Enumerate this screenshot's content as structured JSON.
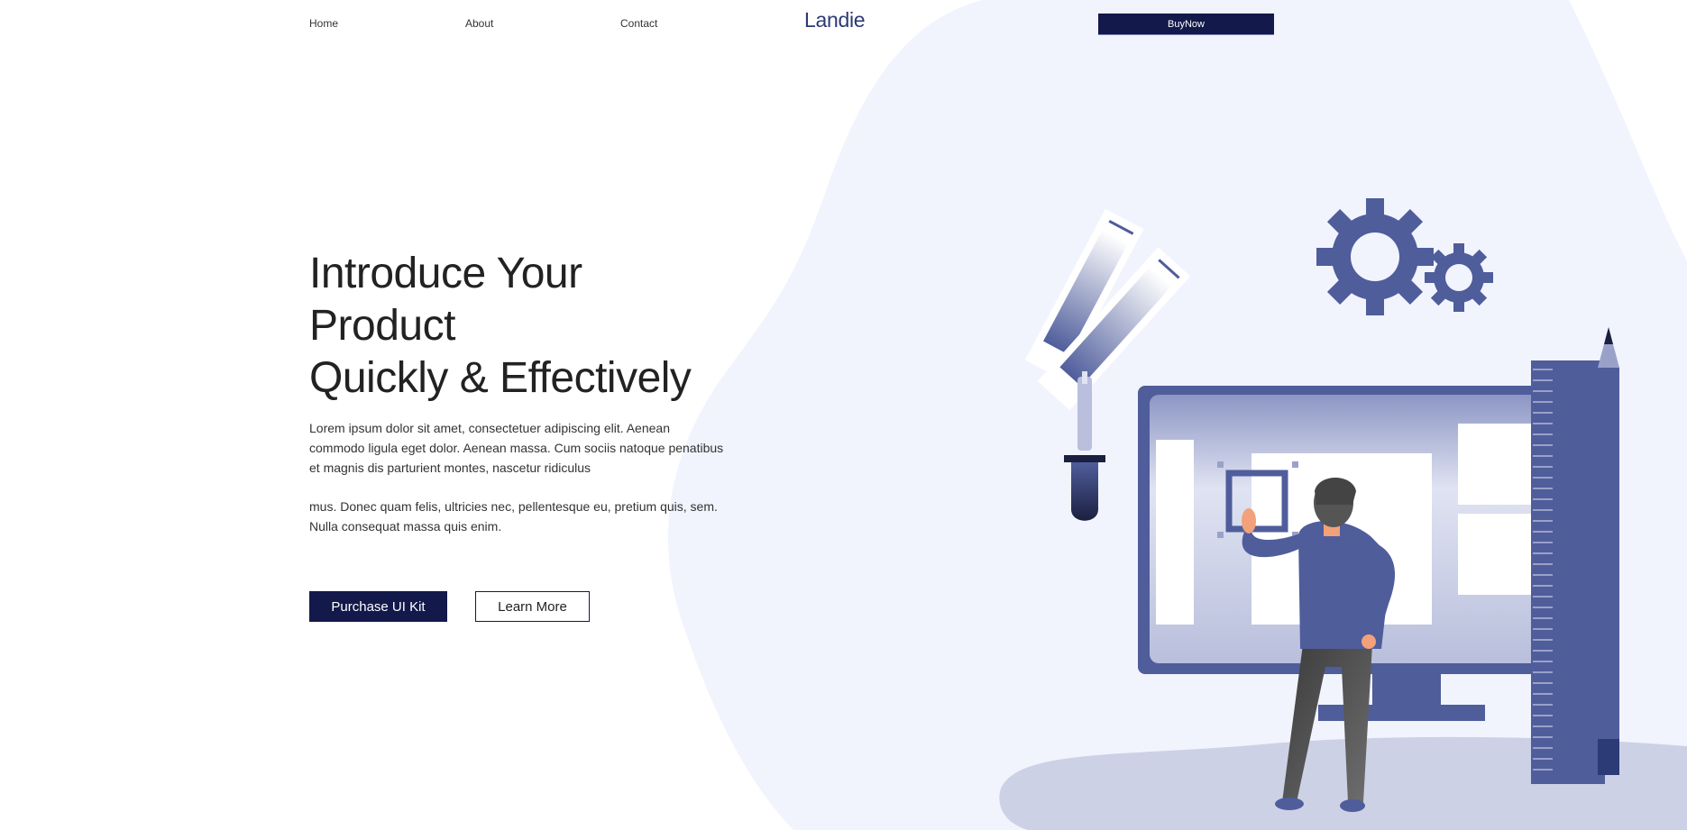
{
  "nav": {
    "links": [
      "Home",
      "About",
      "Contact"
    ],
    "brand": "Landie",
    "cta": "BuyNow"
  },
  "hero": {
    "title_lines": [
      "Introduce Your",
      "Product",
      "Quickly & Effectively"
    ],
    "paragraph_1": "Lorem ipsum dolor sit amet, consectetuer adipiscing elit. Aenean commodo ligula eget dolor. Aenean massa. Cum sociis natoque penatibus et magnis dis parturient montes, nascetur ridiculus",
    "paragraph_2": "mus. Donec quam felis, ultricies nec, pellentesque eu, pretium quis, sem. Nulla consequat massa quis enim.",
    "primary_button": "Purchase UI Kit",
    "secondary_button": "Learn More"
  },
  "colors": {
    "navy": "#13194a",
    "brand": "#2c3a75",
    "accent": "#4f5d9b",
    "blob": "#f1f4fd"
  },
  "icons": [
    "gear-icon",
    "color-swatch-icon",
    "eyedropper-icon",
    "pencil-icon",
    "ruler-icon"
  ]
}
